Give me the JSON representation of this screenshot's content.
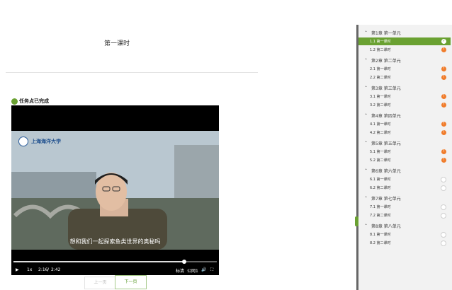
{
  "page": {
    "title": "第一课时",
    "task_status": "任务点已完成"
  },
  "video": {
    "logo_text": "上海海洋大学",
    "subtitle": "想和我们一起探索鱼类世界的奥秘吗",
    "play_icon": "play-icon",
    "speed": "1x",
    "current_time": "2:16",
    "separator": "/",
    "total_time": "2:42",
    "quality": "标清",
    "line": "公网1",
    "progress": 0.84
  },
  "pager": {
    "prev": "上一页",
    "next": "下一页"
  },
  "sidebar": {
    "chapters": [
      {
        "title": "第1章 第一单元",
        "lessons": [
          {
            "label": "1.1 第一课时",
            "status": "done",
            "active": true
          },
          {
            "label": "1.2 第二课时",
            "status": "warn"
          }
        ]
      },
      {
        "title": "第2章 第二单元",
        "lessons": [
          {
            "label": "2.1 第一课时",
            "status": "warn"
          },
          {
            "label": "2.2 第二课时",
            "status": "warn"
          }
        ]
      },
      {
        "title": "第3章 第三单元",
        "lessons": [
          {
            "label": "3.1 第一课时",
            "status": "warn"
          },
          {
            "label": "3.2 第二课时",
            "status": "warn"
          }
        ]
      },
      {
        "title": "第4章 第四单元",
        "lessons": [
          {
            "label": "4.1 第一课时",
            "status": "warn"
          },
          {
            "label": "4.2 第二课时",
            "status": "warn"
          }
        ]
      },
      {
        "title": "第5章 第五单元",
        "lessons": [
          {
            "label": "5.1 第一课时",
            "status": "warn"
          },
          {
            "label": "5.2 第二课时",
            "status": "warn"
          }
        ]
      },
      {
        "title": "第6章 第六单元",
        "lessons": [
          {
            "label": "6.1 第一课时",
            "status": "empty"
          },
          {
            "label": "6.2 第二课时",
            "status": "empty"
          }
        ]
      },
      {
        "title": "第7章 第七单元",
        "lessons": [
          {
            "label": "7.1 第一课时",
            "status": "empty"
          },
          {
            "label": "7.2 第二课时",
            "status": "empty"
          }
        ]
      },
      {
        "title": "第8章 第八单元",
        "lessons": [
          {
            "label": "8.1 第一课时",
            "status": "empty"
          },
          {
            "label": "8.2 第二课时",
            "status": "empty"
          }
        ]
      }
    ]
  },
  "colors": {
    "accent": "#6aa132",
    "warn": "#f07c2b"
  }
}
